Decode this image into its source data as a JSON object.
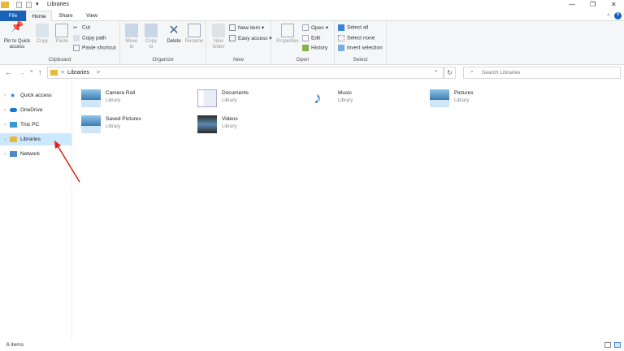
{
  "window": {
    "title": "Libraries",
    "minimize": "—",
    "maximize": "❐",
    "close": "✕"
  },
  "tabs": [
    {
      "label": "File"
    },
    {
      "label": "Home"
    },
    {
      "label": "Share"
    },
    {
      "label": "View"
    }
  ],
  "ribbon": {
    "clipboard": {
      "label": "Clipboard",
      "pin": "Pin to Quick access",
      "copy": "Copy",
      "paste": "Paste",
      "cut": "Cut",
      "copy_path": "Copy path",
      "paste_shortcut": "Paste shortcut"
    },
    "organize": {
      "label": "Organize",
      "move_to": "Move to",
      "copy_to": "Copy to",
      "delete": "Delete",
      "rename": "Rename"
    },
    "new": {
      "label": "New",
      "new_folder": "New folder",
      "new_item": "New item ▾",
      "easy_access": "Easy access ▾"
    },
    "open": {
      "label": "Open",
      "properties": "Properties",
      "open": "Open ▾",
      "edit": "Edit",
      "history": "History"
    },
    "select": {
      "label": "Select",
      "select_all": "Select all",
      "select_none": "Select none",
      "invert": "Invert selection"
    }
  },
  "address": {
    "path": "Libraries",
    "separator": ">",
    "search_placeholder": "Search Libraries"
  },
  "nav": [
    {
      "label": "Quick access"
    },
    {
      "label": "OneDrive"
    },
    {
      "label": "This PC"
    },
    {
      "label": "Libraries"
    },
    {
      "label": "Network"
    }
  ],
  "items": [
    {
      "name": "Camera Roll",
      "type": "Library"
    },
    {
      "name": "Documents",
      "type": "Library"
    },
    {
      "name": "Music",
      "type": "Library"
    },
    {
      "name": "Pictures",
      "type": "Library"
    },
    {
      "name": "Saved Pictures",
      "type": "Library"
    },
    {
      "name": "Videos",
      "type": "Library"
    }
  ],
  "status": {
    "count": "6 items"
  },
  "colors": {
    "accent": "#1a62b8",
    "selection": "#cce8ff",
    "arrow": "#e02020"
  }
}
